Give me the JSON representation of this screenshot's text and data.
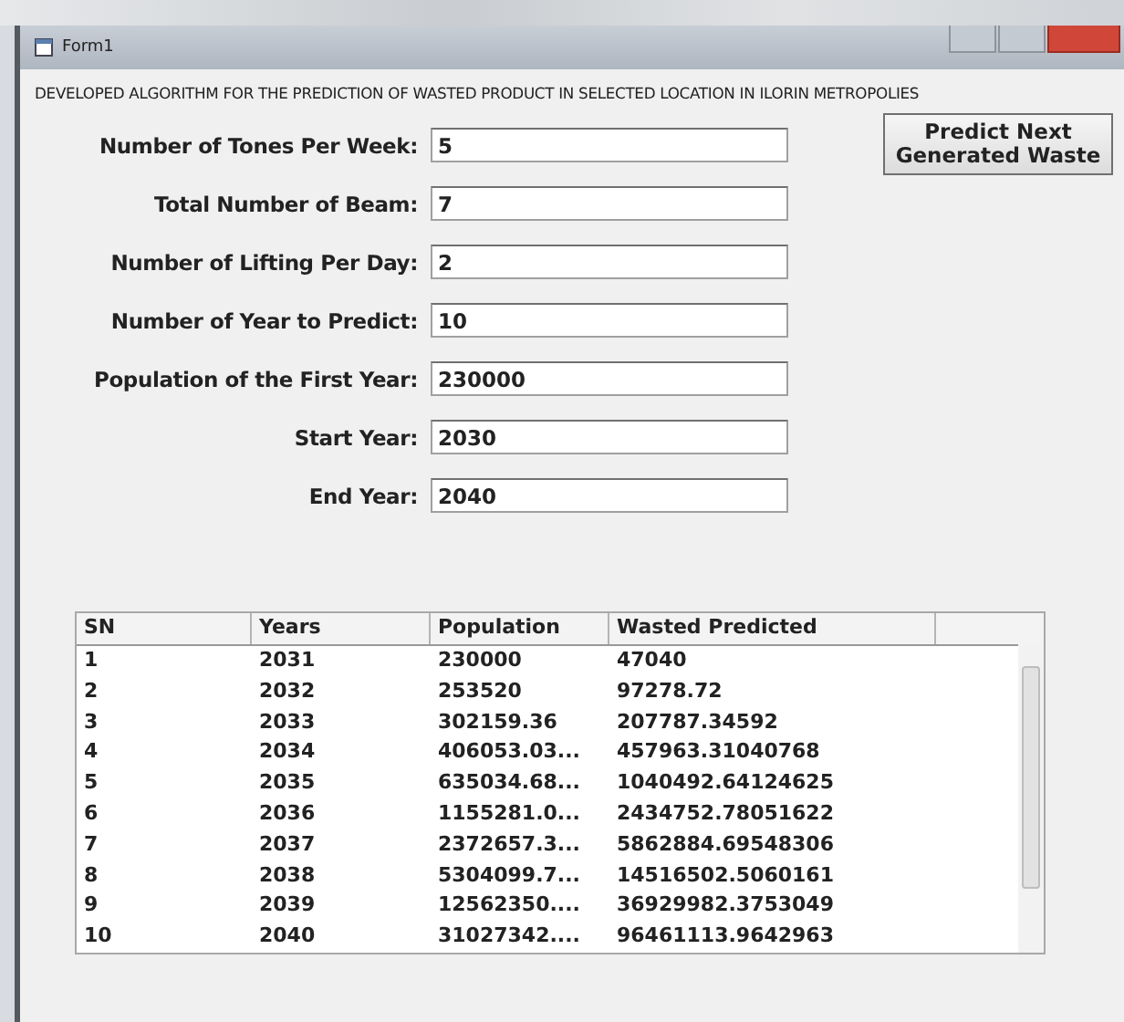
{
  "window": {
    "title": "Form1"
  },
  "heading": "DEVELOPED ALGORITHM FOR THE PREDICTION OF WASTED PRODUCT IN SELECTED LOCATION IN ILORIN METROPOLIES",
  "button": "Predict Next Generated Waste",
  "fields": [
    {
      "label": "Number of Tones Per Week:",
      "value": "5"
    },
    {
      "label": "Total Number of Beam:",
      "value": "7"
    },
    {
      "label": "Number of Lifting Per Day:",
      "value": "2"
    },
    {
      "label": "Number of Year to Predict:",
      "value": "10"
    },
    {
      "label": "Population of the First Year:",
      "value": "230000"
    },
    {
      "label": "Start Year:",
      "value": "2030"
    },
    {
      "label": "End Year:",
      "value": "2040"
    }
  ],
  "table": {
    "columns": [
      "SN",
      "Years",
      "Population",
      "Wasted Predicted"
    ],
    "rows": [
      [
        "1",
        "2031",
        "230000",
        "47040"
      ],
      [
        "2",
        "2032",
        "253520",
        "97278.72"
      ],
      [
        "3",
        "2033",
        "302159.36",
        "207787.34592"
      ],
      [
        "4",
        "2034",
        "406053.03...",
        "457963.31040768"
      ],
      [
        "5",
        "2035",
        "635034.68...",
        "1040492.64124625"
      ],
      [
        "6",
        "2036",
        "1155281.0...",
        "2434752.78051622"
      ],
      [
        "7",
        "2037",
        "2372657.3...",
        "5862884.69548306"
      ],
      [
        "8",
        "2038",
        "5304099.7...",
        "14516502.5060161"
      ],
      [
        "9",
        "2039",
        "12562350....",
        "36929982.3753049"
      ],
      [
        "10",
        "2040",
        "31027342....",
        "96461113.9642963"
      ]
    ]
  }
}
